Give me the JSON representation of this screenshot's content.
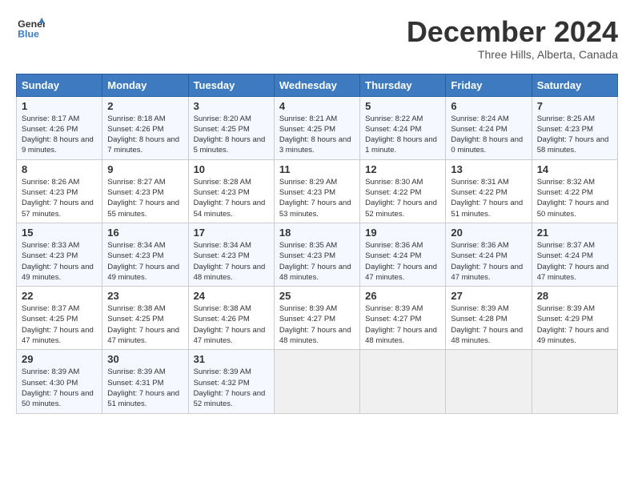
{
  "logo": {
    "line1": "General",
    "line2": "Blue"
  },
  "title": "December 2024",
  "location": "Three Hills, Alberta, Canada",
  "days_of_week": [
    "Sunday",
    "Monday",
    "Tuesday",
    "Wednesday",
    "Thursday",
    "Friday",
    "Saturday"
  ],
  "weeks": [
    [
      {
        "day": "1",
        "sunrise": "8:17 AM",
        "sunset": "4:26 PM",
        "daylight": "8 hours and 9 minutes."
      },
      {
        "day": "2",
        "sunrise": "8:18 AM",
        "sunset": "4:26 PM",
        "daylight": "8 hours and 7 minutes."
      },
      {
        "day": "3",
        "sunrise": "8:20 AM",
        "sunset": "4:25 PM",
        "daylight": "8 hours and 5 minutes."
      },
      {
        "day": "4",
        "sunrise": "8:21 AM",
        "sunset": "4:25 PM",
        "daylight": "8 hours and 3 minutes."
      },
      {
        "day": "5",
        "sunrise": "8:22 AM",
        "sunset": "4:24 PM",
        "daylight": "8 hours and 1 minute."
      },
      {
        "day": "6",
        "sunrise": "8:24 AM",
        "sunset": "4:24 PM",
        "daylight": "8 hours and 0 minutes."
      },
      {
        "day": "7",
        "sunrise": "8:25 AM",
        "sunset": "4:23 PM",
        "daylight": "7 hours and 58 minutes."
      }
    ],
    [
      {
        "day": "8",
        "sunrise": "8:26 AM",
        "sunset": "4:23 PM",
        "daylight": "7 hours and 57 minutes."
      },
      {
        "day": "9",
        "sunrise": "8:27 AM",
        "sunset": "4:23 PM",
        "daylight": "7 hours and 55 minutes."
      },
      {
        "day": "10",
        "sunrise": "8:28 AM",
        "sunset": "4:23 PM",
        "daylight": "7 hours and 54 minutes."
      },
      {
        "day": "11",
        "sunrise": "8:29 AM",
        "sunset": "4:23 PM",
        "daylight": "7 hours and 53 minutes."
      },
      {
        "day": "12",
        "sunrise": "8:30 AM",
        "sunset": "4:22 PM",
        "daylight": "7 hours and 52 minutes."
      },
      {
        "day": "13",
        "sunrise": "8:31 AM",
        "sunset": "4:22 PM",
        "daylight": "7 hours and 51 minutes."
      },
      {
        "day": "14",
        "sunrise": "8:32 AM",
        "sunset": "4:22 PM",
        "daylight": "7 hours and 50 minutes."
      }
    ],
    [
      {
        "day": "15",
        "sunrise": "8:33 AM",
        "sunset": "4:23 PM",
        "daylight": "7 hours and 49 minutes."
      },
      {
        "day": "16",
        "sunrise": "8:34 AM",
        "sunset": "4:23 PM",
        "daylight": "7 hours and 49 minutes."
      },
      {
        "day": "17",
        "sunrise": "8:34 AM",
        "sunset": "4:23 PM",
        "daylight": "7 hours and 48 minutes."
      },
      {
        "day": "18",
        "sunrise": "8:35 AM",
        "sunset": "4:23 PM",
        "daylight": "7 hours and 48 minutes."
      },
      {
        "day": "19",
        "sunrise": "8:36 AM",
        "sunset": "4:24 PM",
        "daylight": "7 hours and 47 minutes."
      },
      {
        "day": "20",
        "sunrise": "8:36 AM",
        "sunset": "4:24 PM",
        "daylight": "7 hours and 47 minutes."
      },
      {
        "day": "21",
        "sunrise": "8:37 AM",
        "sunset": "4:24 PM",
        "daylight": "7 hours and 47 minutes."
      }
    ],
    [
      {
        "day": "22",
        "sunrise": "8:37 AM",
        "sunset": "4:25 PM",
        "daylight": "7 hours and 47 minutes."
      },
      {
        "day": "23",
        "sunrise": "8:38 AM",
        "sunset": "4:25 PM",
        "daylight": "7 hours and 47 minutes."
      },
      {
        "day": "24",
        "sunrise": "8:38 AM",
        "sunset": "4:26 PM",
        "daylight": "7 hours and 47 minutes."
      },
      {
        "day": "25",
        "sunrise": "8:39 AM",
        "sunset": "4:27 PM",
        "daylight": "7 hours and 48 minutes."
      },
      {
        "day": "26",
        "sunrise": "8:39 AM",
        "sunset": "4:27 PM",
        "daylight": "7 hours and 48 minutes."
      },
      {
        "day": "27",
        "sunrise": "8:39 AM",
        "sunset": "4:28 PM",
        "daylight": "7 hours and 48 minutes."
      },
      {
        "day": "28",
        "sunrise": "8:39 AM",
        "sunset": "4:29 PM",
        "daylight": "7 hours and 49 minutes."
      }
    ],
    [
      {
        "day": "29",
        "sunrise": "8:39 AM",
        "sunset": "4:30 PM",
        "daylight": "7 hours and 50 minutes."
      },
      {
        "day": "30",
        "sunrise": "8:39 AM",
        "sunset": "4:31 PM",
        "daylight": "7 hours and 51 minutes."
      },
      {
        "day": "31",
        "sunrise": "8:39 AM",
        "sunset": "4:32 PM",
        "daylight": "7 hours and 52 minutes."
      },
      null,
      null,
      null,
      null
    ]
  ]
}
